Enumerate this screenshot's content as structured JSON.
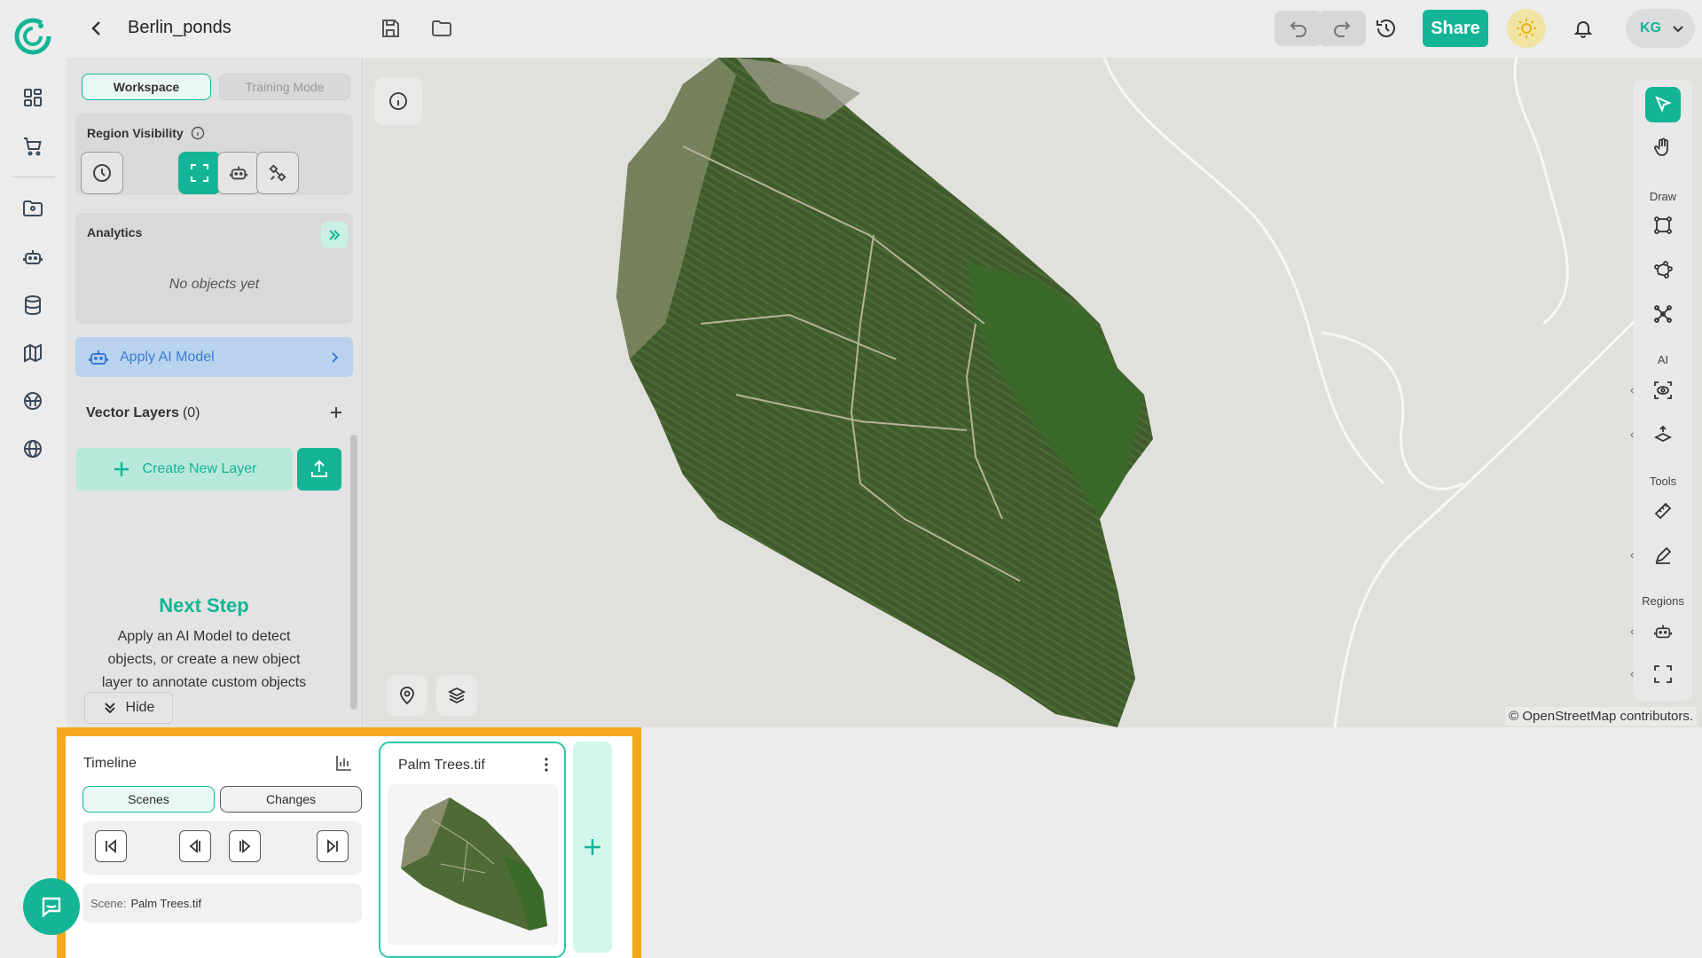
{
  "colors": {
    "accent": "#13b596",
    "highlight": "#f5a81c",
    "link_blue": "#3a7bd5"
  },
  "header": {
    "title": "Berlin_ponds",
    "share_label": "Share",
    "user_initials": "KG"
  },
  "panel": {
    "tabs": {
      "workspace": "Workspace",
      "training": "Training Mode"
    },
    "region_visibility": {
      "title": "Region Visibility"
    },
    "analytics": {
      "title": "Analytics",
      "empty": "No objects yet"
    },
    "apply_ai": "Apply AI Model",
    "vector_layers": {
      "title": "Vector Layers",
      "count": "(0)"
    },
    "create_layer": "Create New Layer",
    "next_step": {
      "title": "Next Step",
      "text": "Apply an AI Model to detect objects, or create a new object layer to annotate custom objects"
    },
    "hide_label": "Hide"
  },
  "map": {
    "attribution": "© OpenStreetMap contributors."
  },
  "right_toolbar": {
    "draw": "Draw",
    "ai": "AI",
    "tools": "Tools",
    "regions": "Regions"
  },
  "timeline": {
    "title": "Timeline",
    "tabs": {
      "scenes": "Scenes",
      "changes": "Changes"
    },
    "scene_prefix": "Scene:",
    "scene_value": "Palm Trees.tif",
    "scene_card_name": "Palm Trees.tif"
  }
}
